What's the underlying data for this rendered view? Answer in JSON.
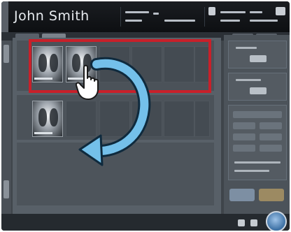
{
  "header": {
    "patient_name": "John Smith"
  },
  "colors": {
    "highlight": "#c8202a",
    "arrow": "#74c0ea"
  },
  "annotations": {
    "gesture": "hand-pointer-icon",
    "motion": "rotate-clockwise-arrow-icon"
  }
}
